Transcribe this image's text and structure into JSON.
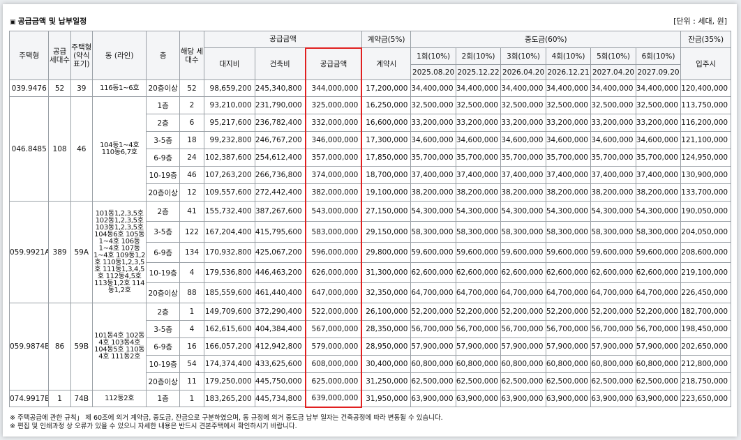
{
  "title": "공급금액 및 납부일정",
  "title_marker": "▣",
  "unit": "[단위 : 세대, 원]",
  "headers": {
    "type": "주택형",
    "supply_units": "공급 세대수",
    "type_short": "주택형 (약식 표기)",
    "dong": "동 (라인)",
    "floor": "층",
    "floor_units": "해당 세대수",
    "supply_amount": "공급금액",
    "land": "대지비",
    "building": "건축비",
    "supply": "공급금액",
    "deposit": "계약금(5%)",
    "deposit_timing": "계약시",
    "middle": "중도금(60%)",
    "balance": "잔금(35%)",
    "balance_timing": "입주시",
    "installments": [
      {
        "label": "1회(10%)",
        "date": "2025.08.20"
      },
      {
        "label": "2회(10%)",
        "date": "2025.12.22"
      },
      {
        "label": "3회(10%)",
        "date": "2026.04.20"
      },
      {
        "label": "4회(10%)",
        "date": "2026.12.21"
      },
      {
        "label": "5회(10%)",
        "date": "2027.04.20"
      },
      {
        "label": "6회(10%)",
        "date": "2027.09.20"
      }
    ]
  },
  "groups": [
    {
      "type": "039.9476",
      "units": "52",
      "short": "39",
      "dong": "116동1~6호",
      "rows": [
        {
          "floor": "20층이상",
          "n": "52",
          "land": "98,659,200",
          "build": "245,340,800",
          "supply": "344,000,000",
          "dep": "17,200,000",
          "mid": "34,400,000",
          "bal": "120,400,000"
        }
      ]
    },
    {
      "type": "046.8485",
      "units": "108",
      "short": "46",
      "dong": "104동1~4호 110동6,7호",
      "rows": [
        {
          "floor": "1층",
          "n": "2",
          "land": "93,210,000",
          "build": "231,790,000",
          "supply": "325,000,000",
          "dep": "16,250,000",
          "mid": "32,500,000",
          "bal": "113,750,000"
        },
        {
          "floor": "2층",
          "n": "6",
          "land": "95,217,600",
          "build": "236,782,400",
          "supply": "332,000,000",
          "dep": "16,600,000",
          "mid": "33,200,000",
          "bal": "116,200,000"
        },
        {
          "floor": "3-5층",
          "n": "18",
          "land": "99,232,800",
          "build": "246,767,200",
          "supply": "346,000,000",
          "dep": "17,300,000",
          "mid": "34,600,000",
          "bal": "121,100,000"
        },
        {
          "floor": "6-9층",
          "n": "24",
          "land": "102,387,600",
          "build": "254,612,400",
          "supply": "357,000,000",
          "dep": "17,850,000",
          "mid": "35,700,000",
          "bal": "124,950,000"
        },
        {
          "floor": "10-19층",
          "n": "46",
          "land": "107,263,200",
          "build": "266,736,800",
          "supply": "374,000,000",
          "dep": "18,700,000",
          "mid": "37,400,000",
          "bal": "130,900,000"
        },
        {
          "floor": "20층이상",
          "n": "12",
          "land": "109,557,600",
          "build": "272,442,400",
          "supply": "382,000,000",
          "dep": "19,100,000",
          "mid": "38,200,000",
          "bal": "133,700,000"
        }
      ]
    },
    {
      "type": "059.9921A",
      "units": "389",
      "short": "59A",
      "dong": "101동1,2,3,5호 102동1,2,3,5호 103동1,2,3,5호 104동6호 105동1~4호 106동1~4호 107동1~4호 109동1,2호 110동1,2,3,5호 111동1,3,4,5호 112동4,5호 113동1,2호 114동1,2호",
      "rows": [
        {
          "floor": "2층",
          "n": "41",
          "land": "155,732,400",
          "build": "387,267,600",
          "supply": "543,000,000",
          "dep": "27,150,000",
          "mid": "54,300,000",
          "bal": "190,050,000"
        },
        {
          "floor": "3-5층",
          "n": "122",
          "land": "167,204,400",
          "build": "415,795,600",
          "supply": "583,000,000",
          "dep": "29,150,000",
          "mid": "58,300,000",
          "bal": "204,050,000"
        },
        {
          "floor": "6-9층",
          "n": "134",
          "land": "170,932,800",
          "build": "425,067,200",
          "supply": "596,000,000",
          "dep": "29,800,000",
          "mid": "59,600,000",
          "bal": "208,600,000"
        },
        {
          "floor": "10-19층",
          "n": "4",
          "land": "179,536,800",
          "build": "446,463,200",
          "supply": "626,000,000",
          "dep": "31,300,000",
          "mid": "62,600,000",
          "bal": "219,100,000"
        },
        {
          "floor": "20층이상",
          "n": "88",
          "land": "185,559,600",
          "build": "461,440,400",
          "supply": "647,000,000",
          "dep": "32,350,000",
          "mid": "64,700,000",
          "bal": "226,450,000"
        }
      ]
    },
    {
      "type": "059.9874B",
      "units": "86",
      "short": "59B",
      "dong": "101동4호 102동4호 103동4호 104동5호 110동4호 111동2호",
      "rows": [
        {
          "floor": "2층",
          "n": "1",
          "land": "149,709,600",
          "build": "372,290,400",
          "supply": "522,000,000",
          "dep": "26,100,000",
          "mid": "52,200,000",
          "bal": "182,700,000"
        },
        {
          "floor": "3-5층",
          "n": "4",
          "land": "162,615,600",
          "build": "404,384,400",
          "supply": "567,000,000",
          "dep": "28,350,000",
          "mid": "56,700,000",
          "bal": "198,450,000"
        },
        {
          "floor": "6-9층",
          "n": "16",
          "land": "166,057,200",
          "build": "412,942,800",
          "supply": "579,000,000",
          "dep": "28,950,000",
          "mid": "57,900,000",
          "bal": "202,650,000"
        },
        {
          "floor": "10-19층",
          "n": "54",
          "land": "174,374,400",
          "build": "433,625,600",
          "supply": "608,000,000",
          "dep": "30,400,000",
          "mid": "60,800,000",
          "bal": "212,800,000"
        },
        {
          "floor": "20층이상",
          "n": "11",
          "land": "179,250,000",
          "build": "445,750,000",
          "supply": "625,000,000",
          "dep": "31,250,000",
          "mid": "62,500,000",
          "bal": "218,750,000"
        }
      ]
    },
    {
      "type": "074.9917B",
      "units": "1",
      "short": "74B",
      "dong": "112동2호",
      "rows": [
        {
          "floor": "1층",
          "n": "1",
          "land": "183,265,200",
          "build": "445,734,800",
          "supply": "639,000,000",
          "dep": "31,950,000",
          "mid": "63,900,000",
          "bal": "223,650,000"
        }
      ]
    }
  ],
  "notes": [
    "※ 주택공급에 관한 규칙」 제 60조에 의거 계약금, 중도금, 잔금으로 구분하였으며, 동 규정에 의거 중도금 납부 일자는 건축공정에 따라 변동될 수 있습니다.",
    "※ 편집 및 인쇄과정 상 오류가 있을 수 있으니 자세한 내용은 반드시 견본주택에서 확인하시기 바랍니다."
  ],
  "colors": {
    "highlight": "#e02020",
    "header_bg": "#f4f5f7",
    "border": "#9aa0a6"
  }
}
